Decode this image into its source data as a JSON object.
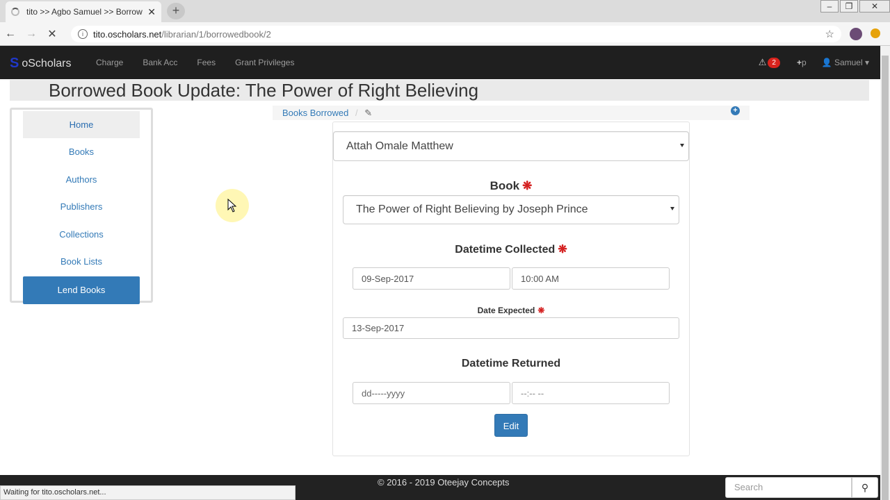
{
  "browser": {
    "tab_title": "tito >> Agbo Samuel >> Borrow",
    "new_tab": "+",
    "url_host": "tito.oscholars.net",
    "url_path": "/librarian/1/borrowedbook/2",
    "status": "Waiting for tito.oscholars.net..."
  },
  "nav": {
    "brand": "oScholars",
    "links": [
      "Charge",
      "Bank Acc",
      "Fees",
      "Grant Privileges"
    ],
    "alert_count": "2",
    "plus_label": "p",
    "user": "Samuel"
  },
  "page": {
    "title": "Borrowed Book Update: The Power of Right Believing"
  },
  "sidebar": {
    "items": [
      "Home",
      "Books",
      "Authors",
      "Publishers",
      "Collections",
      "Book Lists",
      "Lend Books"
    ]
  },
  "breadcrumb": {
    "link": "Books Borrowed"
  },
  "form": {
    "borrower": "Attah Omale Matthew",
    "book_label": "Book",
    "book_value": "The Power of Right Believing by Joseph Prince",
    "collected_label": "Datetime Collected",
    "collected_date": "09-Sep-2017",
    "collected_time": "10:00 AM",
    "expected_label": "Date Expected",
    "expected_date": "13-Sep-2017",
    "returned_label": "Datetime Returned",
    "returned_date_placeholder": "dd-----yyyy",
    "returned_time_placeholder": "--:-- --",
    "required_mark": "❋",
    "submit": "Edit"
  },
  "footer": {
    "copyright": "© 2016 - 2019 Oteejay Concepts",
    "search_placeholder": "Search"
  }
}
